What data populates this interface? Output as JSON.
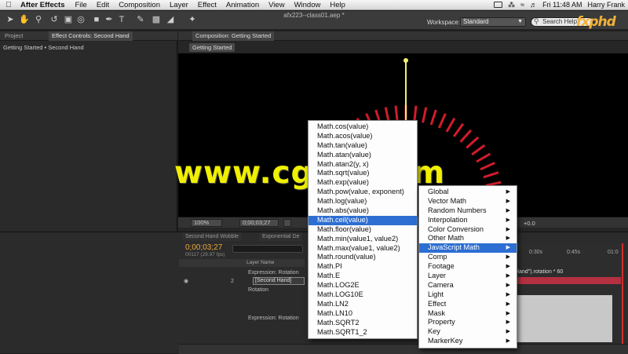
{
  "menubar": {
    "app_name": "After Effects",
    "items": [
      "File",
      "Edit",
      "Composition",
      "Layer",
      "Effect",
      "Animation",
      "View",
      "Window",
      "Help"
    ],
    "clock": "Fri 11:48 AM",
    "user": "Harry Frank"
  },
  "toolbar": {
    "document_title": "afx223--class01.aep *",
    "workspace_label": "Workspace:",
    "workspace_value": "Standard",
    "search_placeholder": "Search Help",
    "logo": "fxphd"
  },
  "left_panel": {
    "tabs": [
      "Project",
      "Effect Controls: Second Hand"
    ],
    "breadcrumb": "Getting Started • Second Hand"
  },
  "composition": {
    "tab_label": "Composition: Getting Started",
    "subtab": "Getting Started",
    "zoom": "100%",
    "timecode": "0;00;03;27",
    "offset": "+0.0"
  },
  "timeline": {
    "tabs": [
      "Second Hand Wobble",
      "Exponential De"
    ],
    "timecode": "0;00;03;27",
    "fps": "00117 (29.97 fps)",
    "layer_header": "Layer Name",
    "rows": [
      {
        "label": "Expression: Rotation"
      },
      {
        "index": "2",
        "name": "[Second Hand]"
      },
      {
        "label": "Rotation"
      },
      {
        "label": "Expression: Rotation"
      }
    ],
    "ruler": [
      "0:30s",
      "0:45s",
      "01:0"
    ],
    "expression_text": "Hand\").rotation * 60"
  },
  "watermark": "www.cgtsj.com",
  "expression_menu": {
    "items": [
      {
        "label": "Global",
        "has_submenu": true
      },
      {
        "label": "Vector Math",
        "has_submenu": true
      },
      {
        "label": "Random Numbers",
        "has_submenu": true
      },
      {
        "label": "Interpolation",
        "has_submenu": true
      },
      {
        "label": "Color Conversion",
        "has_submenu": true
      },
      {
        "label": "Other Math",
        "has_submenu": true
      },
      {
        "label": "JavaScript Math",
        "has_submenu": true,
        "highlighted": true
      },
      {
        "label": "Comp",
        "has_submenu": true
      },
      {
        "label": "Footage",
        "has_submenu": true
      },
      {
        "label": "Layer",
        "has_submenu": true
      },
      {
        "label": "Camera",
        "has_submenu": true
      },
      {
        "label": "Light",
        "has_submenu": true
      },
      {
        "label": "Effect",
        "has_submenu": true
      },
      {
        "label": "Mask",
        "has_submenu": true
      },
      {
        "label": "Property",
        "has_submenu": true
      },
      {
        "label": "Key",
        "has_submenu": true
      },
      {
        "label": "MarkerKey",
        "has_submenu": true
      }
    ]
  },
  "javascript_math_menu": {
    "items": [
      {
        "label": "Math.cos(value)"
      },
      {
        "label": "Math.acos(value)"
      },
      {
        "label": "Math.tan(value)"
      },
      {
        "label": "Math.atan(value)"
      },
      {
        "label": "Math.atan2(y, x)"
      },
      {
        "label": "Math.sqrt(value)"
      },
      {
        "label": "Math.exp(value)"
      },
      {
        "label": "Math.pow(value, exponent)"
      },
      {
        "label": "Math.log(value)"
      },
      {
        "label": "Math.abs(value)"
      },
      {
        "label": "Math.ceil(value)",
        "highlighted": true
      },
      {
        "label": "Math.floor(value)"
      },
      {
        "label": "Math.min(value1, value2)"
      },
      {
        "label": "Math.max(value1, value2)"
      },
      {
        "label": "Math.round(value)"
      },
      {
        "label": "Math.PI"
      },
      {
        "label": "Math.E"
      },
      {
        "label": "Math.LOG2E"
      },
      {
        "label": "Math.LOG10E"
      },
      {
        "label": "Math.LN2"
      },
      {
        "label": "Math.LN10"
      },
      {
        "label": "Math.SQRT2"
      },
      {
        "label": "Math.SQRT1_2"
      }
    ]
  },
  "colors": {
    "highlight": "#2d6ed3",
    "tick_red": "#d21c2c",
    "hand_yellow": "#f0f070",
    "timecode_orange": "#e8a93e",
    "watermark_yellow": "#f0f000"
  }
}
